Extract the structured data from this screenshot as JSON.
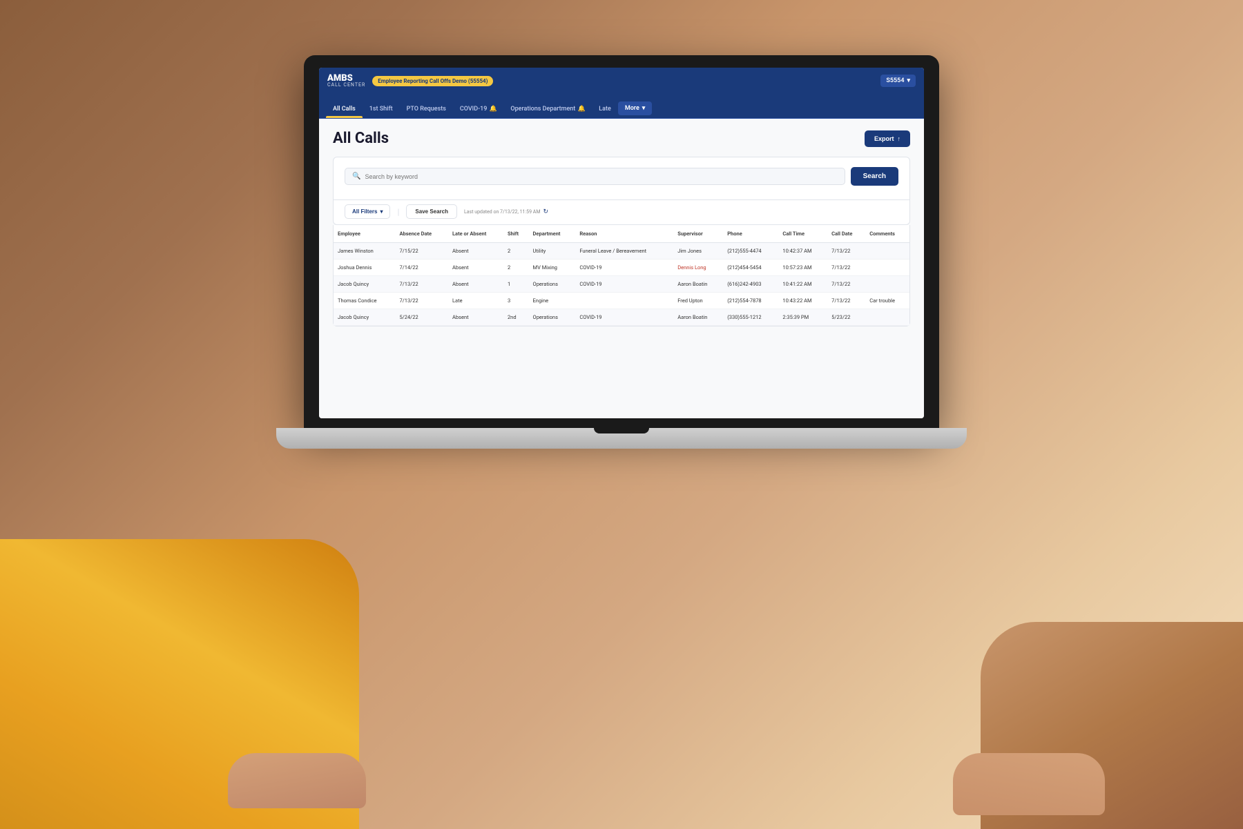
{
  "brand": {
    "name": "AMBS",
    "subtitle": "CALL CENTER",
    "demo_badge": "Employee Reporting Call Offs Demo (55554)",
    "user": "S5554"
  },
  "tabs": [
    {
      "id": "all-calls",
      "label": "All Calls",
      "active": true
    },
    {
      "id": "1st-shift",
      "label": "1st Shift",
      "active": false
    },
    {
      "id": "pto-requests",
      "label": "PTO Requests",
      "active": false
    },
    {
      "id": "covid-19",
      "label": "COVID-19",
      "active": false,
      "bell": true
    },
    {
      "id": "operations-dept",
      "label": "Operations Department",
      "active": false,
      "bell": true
    },
    {
      "id": "late",
      "label": "Late",
      "active": false
    },
    {
      "id": "more",
      "label": "More",
      "active": false,
      "dropdown": true
    }
  ],
  "page": {
    "title": "All Calls",
    "export_label": "Export"
  },
  "search": {
    "placeholder": "Search by keyword",
    "button_label": "Search",
    "all_filters_label": "All Filters",
    "save_search_label": "Save Search",
    "last_updated": "Last updated on 7/13/22, 11:59 AM"
  },
  "table": {
    "columns": [
      "Employee",
      "Absence Date",
      "Late or Absent",
      "Shift",
      "Department",
      "Reason",
      "Supervisor",
      "Phone",
      "Call Time",
      "Call Date",
      "Comments"
    ],
    "rows": [
      {
        "employee": "James Winston",
        "absence_date": "7/15/22",
        "late_or_absent": "Absent",
        "shift": "2",
        "department": "Utility",
        "reason": "Funeral Leave / Bereavement",
        "supervisor": "Jim Jones",
        "supervisor_link": false,
        "phone": "(212)555-4474",
        "call_time": "10:42:37 AM",
        "call_date": "7/13/22",
        "comments": ""
      },
      {
        "employee": "Joshua Dennis",
        "absence_date": "7/14/22",
        "late_or_absent": "Absent",
        "shift": "2",
        "department": "MV Mixing",
        "reason": "COVID-19",
        "supervisor": "Dennis Long",
        "supervisor_link": true,
        "phone": "(212)454-5454",
        "call_time": "10:57:23 AM",
        "call_date": "7/13/22",
        "comments": ""
      },
      {
        "employee": "Jacob Quincy",
        "absence_date": "7/13/22",
        "late_or_absent": "Absent",
        "shift": "1",
        "department": "Operations",
        "reason": "COVID-19",
        "supervisor": "Aaron Boatin",
        "supervisor_link": false,
        "phone": "(616)242-4903",
        "call_time": "10:41:22 AM",
        "call_date": "7/13/22",
        "comments": ""
      },
      {
        "employee": "Thomas Condice",
        "absence_date": "7/13/22",
        "late_or_absent": "Late",
        "shift": "3",
        "department": "Engine",
        "reason": "",
        "supervisor": "Fred Upton",
        "supervisor_link": false,
        "phone": "(212)554-7878",
        "call_time": "10:43:22 AM",
        "call_date": "7/13/22",
        "comments": "Car trouble"
      },
      {
        "employee": "Jacob Quincy",
        "absence_date": "5/24/22",
        "late_or_absent": "Absent",
        "shift": "2nd",
        "department": "Operations",
        "reason": "COVID-19",
        "supervisor": "Aaron Boatin",
        "supervisor_link": false,
        "phone": "(330)555-1212",
        "call_time": "2:35:39 PM",
        "call_date": "5/23/22",
        "comments": ""
      }
    ]
  }
}
